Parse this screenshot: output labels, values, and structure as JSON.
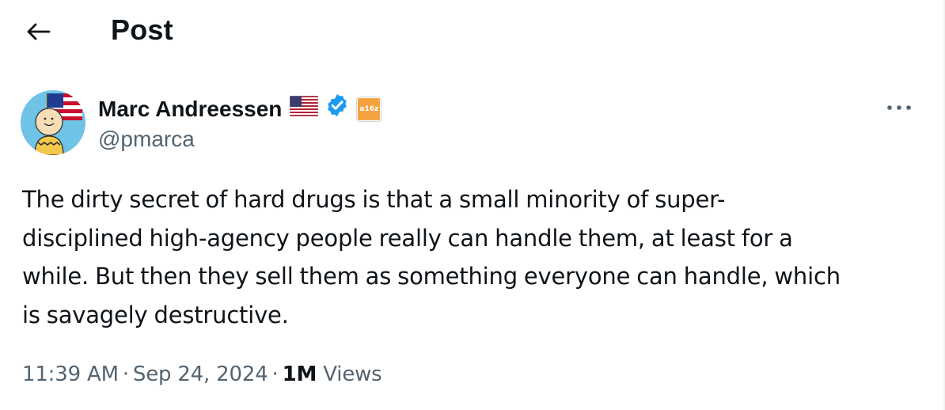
{
  "header": {
    "title": "Post",
    "back_icon": "arrow-left-icon"
  },
  "author": {
    "name": "Marc Andreessen",
    "handle": "@pmarca",
    "flag_icon": "us-flag-icon",
    "verified_icon": "verified-badge-icon",
    "affiliation_badge_text": "a16z"
  },
  "tweet": {
    "lines": [
      "The dirty secret of hard drugs is that a small minority of super-",
      "disciplined high-agency people really can handle them, at least for a",
      "while. But then they sell them as something everyone can handle, which",
      "is savagely destructive."
    ]
  },
  "meta": {
    "time": "11:39 AM",
    "separator": "·",
    "date": "Sep 24, 2024",
    "views_count": "1M",
    "views_label": "Views"
  },
  "colors": {
    "text": "#0f1419",
    "secondary": "#536471",
    "verified": "#1d9bf0",
    "affiliation": "#f5a340"
  }
}
